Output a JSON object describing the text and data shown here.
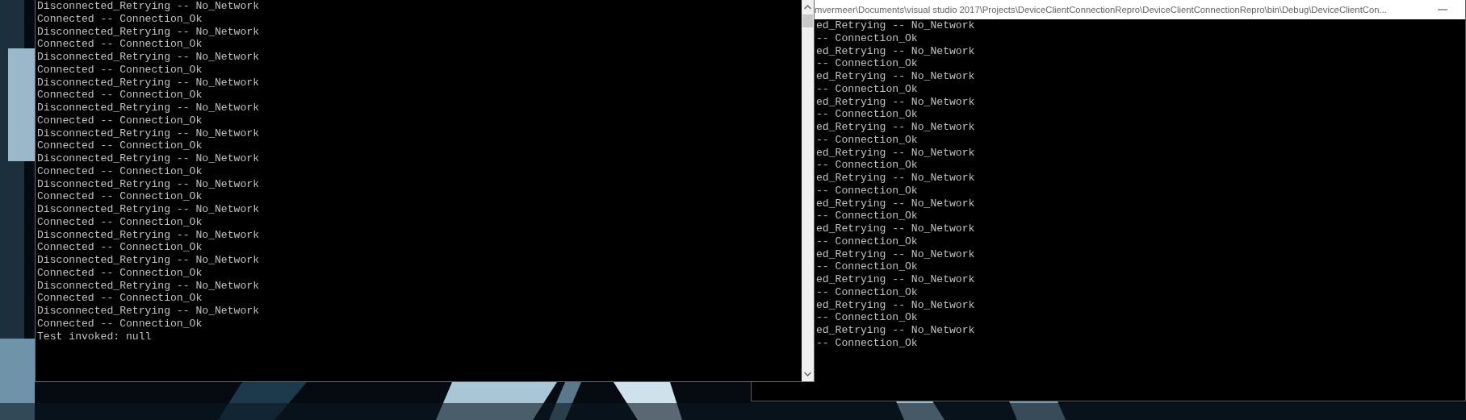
{
  "back_console": {
    "title": "mvermeer\\Documents\\visual studio 2017\\Projects\\DeviceClientConnectionRepro\\DeviceClientConnectionRepro\\bin\\Debug\\DeviceClientCon...",
    "lines": [
      "ed_Retrying -- No_Network",
      "-- Connection_Ok",
      "ed_Retrying -- No_Network",
      "-- Connection_Ok",
      "ed_Retrying -- No_Network",
      "-- Connection_Ok",
      "ed_Retrying -- No_Network",
      "-- Connection_Ok",
      "ed_Retrying -- No_Network",
      "-- Connection_Ok",
      "ed_Retrying -- No_Network",
      "-- Connection_Ok",
      "ed_Retrying -- No_Network",
      "-- Connection_Ok",
      "ed_Retrying -- No_Network",
      "-- Connection_Ok",
      "ed_Retrying -- No_Network",
      "-- Connection_Ok",
      "ed_Retrying -- No_Network",
      "-- Connection_Ok",
      "ed_Retrying -- No_Network",
      "-- Connection_Ok",
      "ed_Retrying -- No_Network",
      "-- Connection_Ok",
      "ed_Retrying -- No_Network",
      "-- Connection_Ok"
    ]
  },
  "front_console": {
    "lines": [
      "Disconnected_Retrying -- No_Network",
      "Connected -- Connection_Ok",
      "Disconnected_Retrying -- No_Network",
      "Connected -- Connection_Ok",
      "Disconnected_Retrying -- No_Network",
      "Connected -- Connection_Ok",
      "Disconnected_Retrying -- No_Network",
      "Connected -- Connection_Ok",
      "Disconnected_Retrying -- No_Network",
      "Connected -- Connection_Ok",
      "Disconnected_Retrying -- No_Network",
      "Connected -- Connection_Ok",
      "Disconnected_Retrying -- No_Network",
      "Connected -- Connection_Ok",
      "Disconnected_Retrying -- No_Network",
      "Connected -- Connection_Ok",
      "Disconnected_Retrying -- No_Network",
      "Connected -- Connection_Ok",
      "Disconnected_Retrying -- No_Network",
      "Connected -- Connection_Ok",
      "Disconnected_Retrying -- No_Network",
      "Connected -- Connection_Ok",
      "Disconnected_Retrying -- No_Network",
      "Connected -- Connection_Ok",
      "Disconnected_Retrying -- No_Network",
      "Connected -- Connection_Ok",
      "Test invoked: null"
    ]
  }
}
